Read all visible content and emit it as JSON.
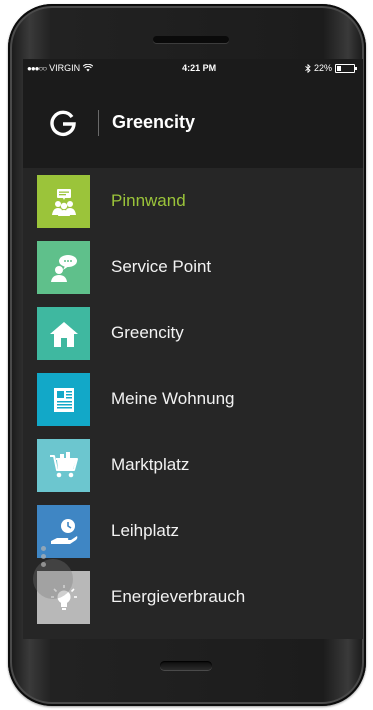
{
  "status": {
    "signal": "●●●○○",
    "carrier": "VIRGIN",
    "wifi_icon": "wifi-icon",
    "time": "4:21 PM",
    "bluetooth_icon": "bluetooth-icon",
    "battery": "22%",
    "battery_level": 0.22
  },
  "header": {
    "logo_letter": "G",
    "title": "Greencity"
  },
  "menu": {
    "items": [
      {
        "label": "Pinnwand",
        "icon": "community-board-icon",
        "color": "#9bc43a",
        "active": true
      },
      {
        "label": "Service Point",
        "icon": "service-chat-icon",
        "color": "#5fc08b",
        "active": false
      },
      {
        "label": "Greencity",
        "icon": "home-icon",
        "color": "#3fb8a0",
        "active": false
      },
      {
        "label": "Meine Wohnung",
        "icon": "newspaper-icon",
        "color": "#12a8c8",
        "active": false
      },
      {
        "label": "Marktplatz",
        "icon": "shopping-cart-icon",
        "color": "#6cc6cf",
        "active": false
      },
      {
        "label": "Leihplatz",
        "icon": "clock-hand-icon",
        "color": "#3f86c4",
        "active": false
      },
      {
        "label": "Energieverbrauch",
        "icon": "lightbulb-icon",
        "color": "#b8b8b8",
        "active": false
      }
    ]
  }
}
